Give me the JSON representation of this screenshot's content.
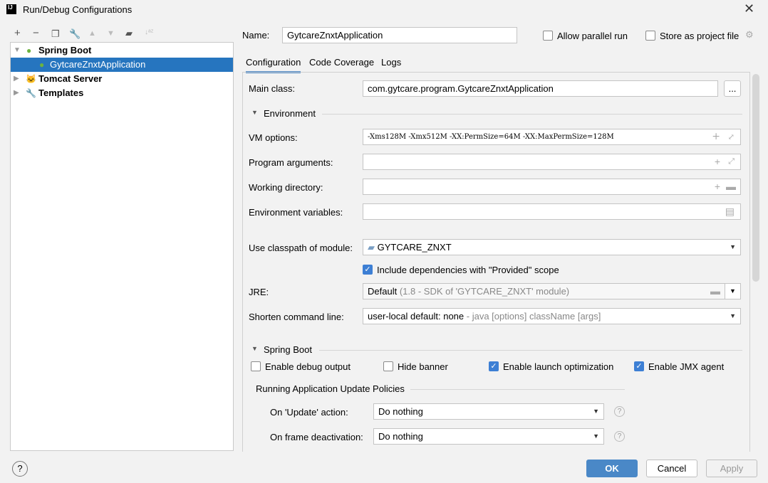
{
  "window": {
    "title": "Run/Debug Configurations",
    "logo": "IJ"
  },
  "toolbar": {
    "icons": [
      "plus-icon",
      "minus-icon",
      "copy-icon",
      "wrench-icon",
      "arrow-up-icon",
      "arrow-down-icon",
      "new-folder-icon",
      "sort-az-icon"
    ]
  },
  "tree": {
    "items": [
      {
        "label": "Spring Boot",
        "icon": "spring-boot-icon"
      },
      {
        "label": "GytcareZnxtApplication",
        "icon": "spring-boot-icon",
        "selected": true
      },
      {
        "label": "Tomcat Server",
        "icon": "tomcat-icon"
      },
      {
        "label": "Templates",
        "icon": "wrench-icon"
      }
    ]
  },
  "header": {
    "name_label": "Name:",
    "name_value": "GytcareZnxtApplication",
    "allow_parallel": "Allow parallel run",
    "store_project": "Store as project file"
  },
  "tabs": [
    "Configuration",
    "Code Coverage",
    "Logs"
  ],
  "config": {
    "main_class_label": "Main class:",
    "main_class": "com.gytcare.program.GytcareZnxtApplication",
    "browse": "...",
    "environment": "Environment",
    "vm_label": "VM options:",
    "vm_value": "-Xms128M -Xmx512M -XX:PermSize=64M -XX:MaxPermSize=128M",
    "prog_label": "Program arguments:",
    "workdir_label": "Working directory:",
    "env_label": "Environment variables:",
    "module_label": "Use classpath of module:",
    "module_value": "GYTCARE_ZNXT",
    "include_deps": "Include dependencies with \"Provided\" scope",
    "jre_label": "JRE:",
    "jre_value": "Default",
    "jre_hint": "(1.8 - SDK of 'GYTCARE_ZNXT' module)",
    "shorten_label": "Shorten command line:",
    "shorten_value": "user-local default: none",
    "shorten_hint": "- java [options] className [args]",
    "spring_boot": "Spring Boot",
    "debug_output": "Enable debug output",
    "hide_banner": "Hide banner",
    "launch_opt": "Enable launch optimization",
    "jmx": "Enable JMX agent",
    "policies": "Running Application Update Policies",
    "update_label": "On 'Update' action:",
    "update_value": "Do nothing",
    "frame_label": "On frame deactivation:",
    "frame_value": "Do nothing"
  },
  "footer": {
    "help": "?",
    "ok": "OK",
    "cancel": "Cancel",
    "apply": "Apply"
  },
  "colors": {
    "selection": "#2675bf",
    "primary_button": "#4a88c7",
    "checkbox": "#3d7fd4"
  }
}
